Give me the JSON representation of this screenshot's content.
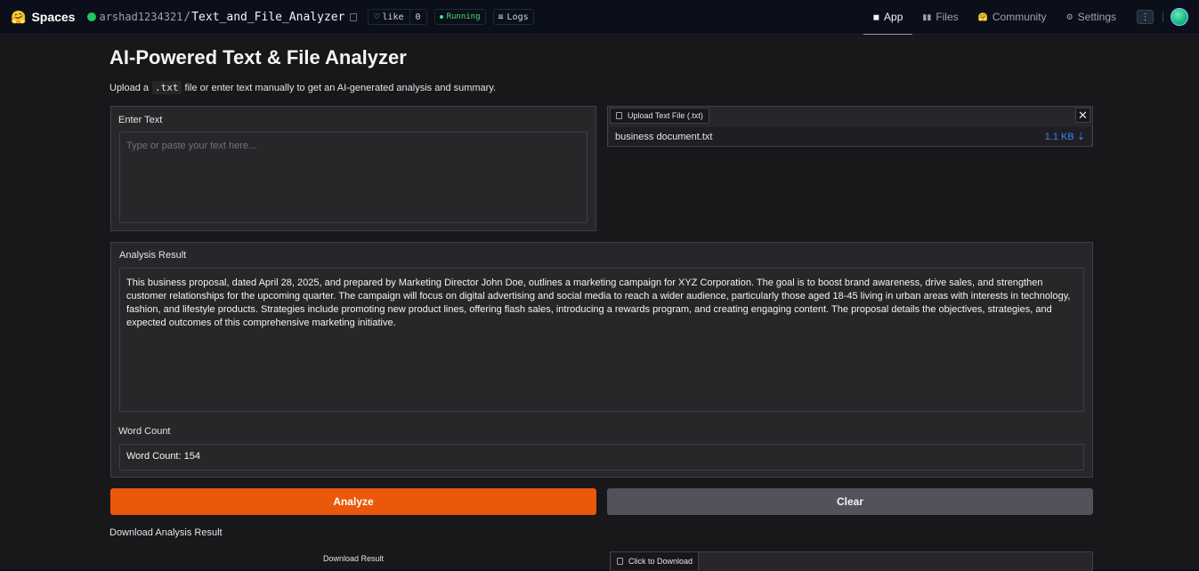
{
  "topbar": {
    "spaces_emoji": "🤗",
    "spaces_label": "Spaces",
    "owner": "arshad1234321",
    "separator": "/",
    "repo": "Text_and_File_Analyzer",
    "like_label": "like",
    "like_count": "0",
    "status": "Running",
    "logs_label": "Logs",
    "nav": [
      {
        "label": "App",
        "icon": "cube-icon",
        "glyph": "◼",
        "active": true
      },
      {
        "label": "Files",
        "icon": "files-icon",
        "glyph": "▮▮",
        "active": false
      },
      {
        "label": "Community",
        "icon": "community-icon",
        "glyph": "🤗",
        "active": false
      },
      {
        "label": "Settings",
        "icon": "gear-icon",
        "glyph": "⚙",
        "active": false
      }
    ],
    "kebab_glyph": "⋮"
  },
  "main": {
    "title": "AI-Powered Text & File Analyzer",
    "subtitle_prefix": "Upload a",
    "subtitle_code": ".txt",
    "subtitle_suffix": "file or enter text manually to get an AI-generated analysis and summary.",
    "enter_text": {
      "label": "Enter Text",
      "placeholder": "Type or paste your text here..."
    },
    "upload": {
      "tab_label": "Upload Text File (.txt)",
      "close_glyph": "✕",
      "file_name": "business document.txt",
      "file_size": "1.1 KB ⇣"
    },
    "analysis": {
      "label": "Analysis Result",
      "text": "This business proposal, dated April 28, 2025, and prepared by Marketing Director John Doe, outlines a marketing campaign for XYZ Corporation. The goal is to boost brand awareness, drive sales, and strengthen customer relationships for the upcoming quarter. The campaign will focus on digital advertising and social media to reach a wider audience, particularly those aged 18-45 living in urban areas with interests in technology, fashion, and lifestyle products. Strategies include promoting new product lines, offering flash sales, introducing a rewards program, and creating engaging content. The proposal details the objectives, strategies, and expected outcomes of this comprehensive marketing initiative."
    },
    "word_count": {
      "label": "Word Count",
      "value": "Word Count: 154"
    },
    "analyze_button": "Analyze",
    "clear_button": "Clear",
    "download_label": "Download Analysis Result",
    "download_result_label": "Download Result",
    "click_to_download": "Click to Download"
  },
  "colors": {
    "primary": "#ea580c",
    "secondary": "#52525b",
    "link": "#3b82f6",
    "running": "#4ade80"
  }
}
